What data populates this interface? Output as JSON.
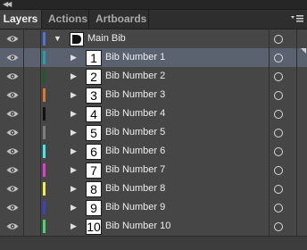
{
  "panel": {
    "tabs": [
      {
        "label": "Layers"
      },
      {
        "label": "Actions"
      },
      {
        "label": "Artboards"
      }
    ]
  },
  "layers": [
    {
      "name": "Main Bib",
      "number": "",
      "color": "#4a74e0",
      "expanded": true,
      "level": 0,
      "selected": false
    },
    {
      "name": "Bib Number 1",
      "number": "1",
      "color": "#1aa6a6",
      "level": 1,
      "selected": true
    },
    {
      "name": "Bib Number 2",
      "number": "2",
      "color": "#1c5c2a",
      "level": 1,
      "selected": false
    },
    {
      "name": "Bib Number 3",
      "number": "3",
      "color": "#e0742a",
      "level": 1,
      "selected": false
    },
    {
      "name": "Bib Number 4",
      "number": "4",
      "color": "#111111",
      "level": 1,
      "selected": false
    },
    {
      "name": "Bib Number 5",
      "number": "5",
      "color": "#7d7d7d",
      "level": 1,
      "selected": false
    },
    {
      "name": "Bib Number 6",
      "number": "6",
      "color": "#42e8ee",
      "level": 1,
      "selected": false
    },
    {
      "name": "Bib Number 7",
      "number": "7",
      "color": "#e43ad8",
      "level": 1,
      "selected": false
    },
    {
      "name": "Bib Number 8",
      "number": "8",
      "color": "#f5ee4a",
      "level": 1,
      "selected": false
    },
    {
      "name": "Bib Number 9",
      "number": "9",
      "color": "#3b3fd0",
      "level": 1,
      "selected": false
    },
    {
      "name": "Bib Number 10",
      "number": "10",
      "color": "#49d866",
      "level": 1,
      "selected": false
    }
  ],
  "icons": {
    "visibility": "eye-icon",
    "expand": "triangle-icon",
    "target": "target-circle-icon",
    "menu": "panel-menu-icon"
  }
}
